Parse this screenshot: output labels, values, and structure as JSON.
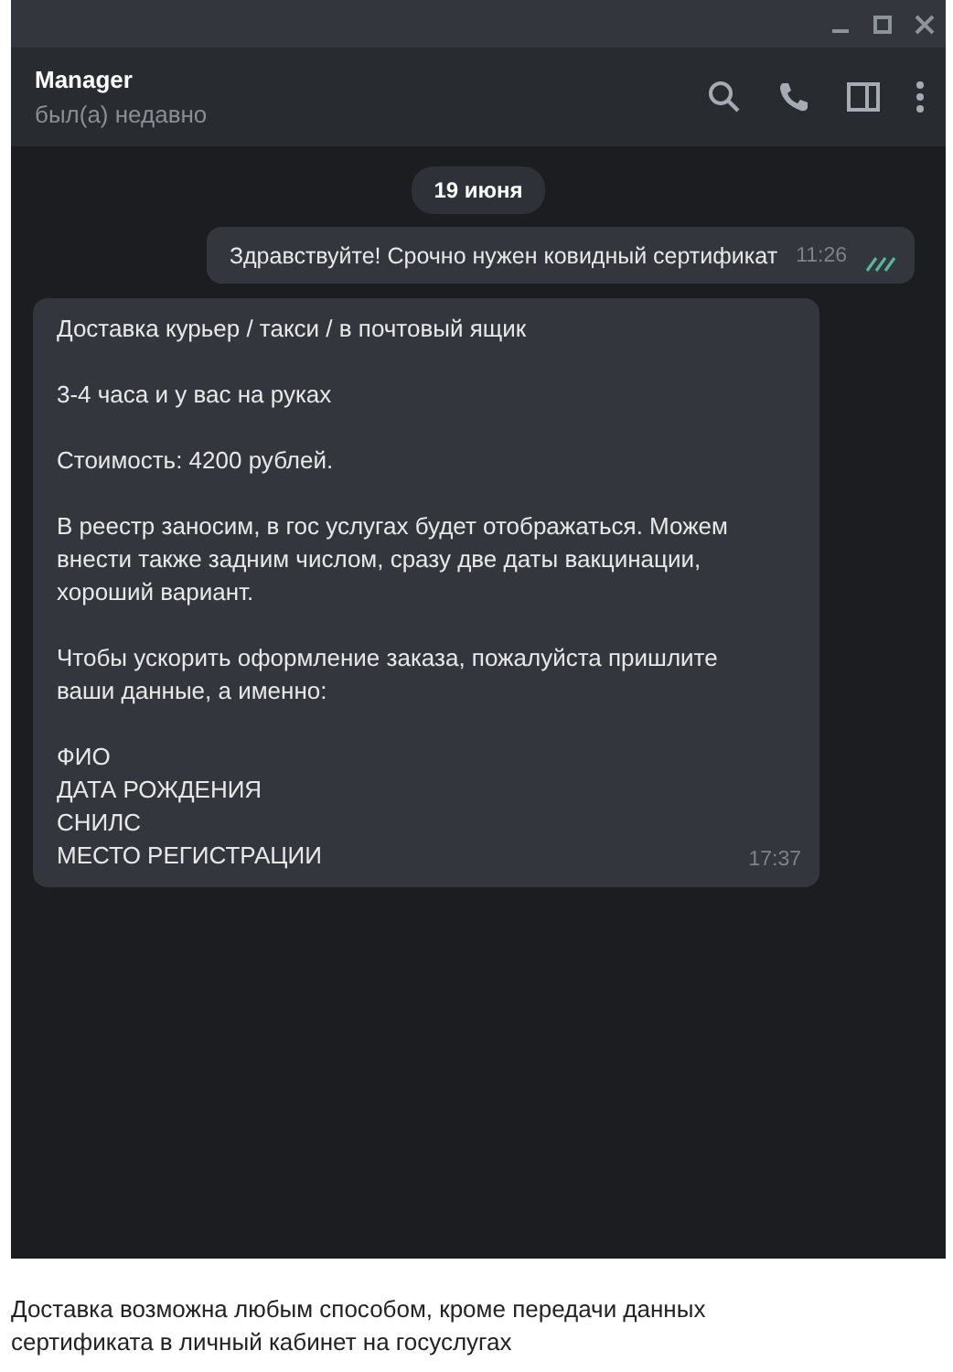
{
  "chat_header": {
    "title": "Manager",
    "status": "был(а) недавно"
  },
  "date_badge": "19 июня",
  "messages": [
    {
      "kind": "outgoing",
      "paragraphs": [
        "Здравствуйте! Срочно нужен ковидный сертификат"
      ],
      "time": "11:26",
      "read": true
    },
    {
      "kind": "incoming",
      "paragraphs": [
        "Доставка курьер / такси / в почтовый ящик",
        "3-4 часа и у вас на руках",
        "Стоимость: 4200 рублей.",
        "В реестр заносим, в гос услугах будет отображаться. Можем внести также задним числом, сразу две даты вакцинации, хороший вариант.",
        "Чтобы ускорить оформление заказа, пожалуйста пришлите ваши данные, а именно:",
        "ФИО\nДАТА РОЖДЕНИЯ\nСНИЛС\nМЕСТО РЕГИСТРАЦИИ"
      ],
      "time": "17:37"
    }
  ],
  "caption": "Доставка возможна любым способом, кроме передачи данных сертификата в личный кабинет на госуслугах"
}
